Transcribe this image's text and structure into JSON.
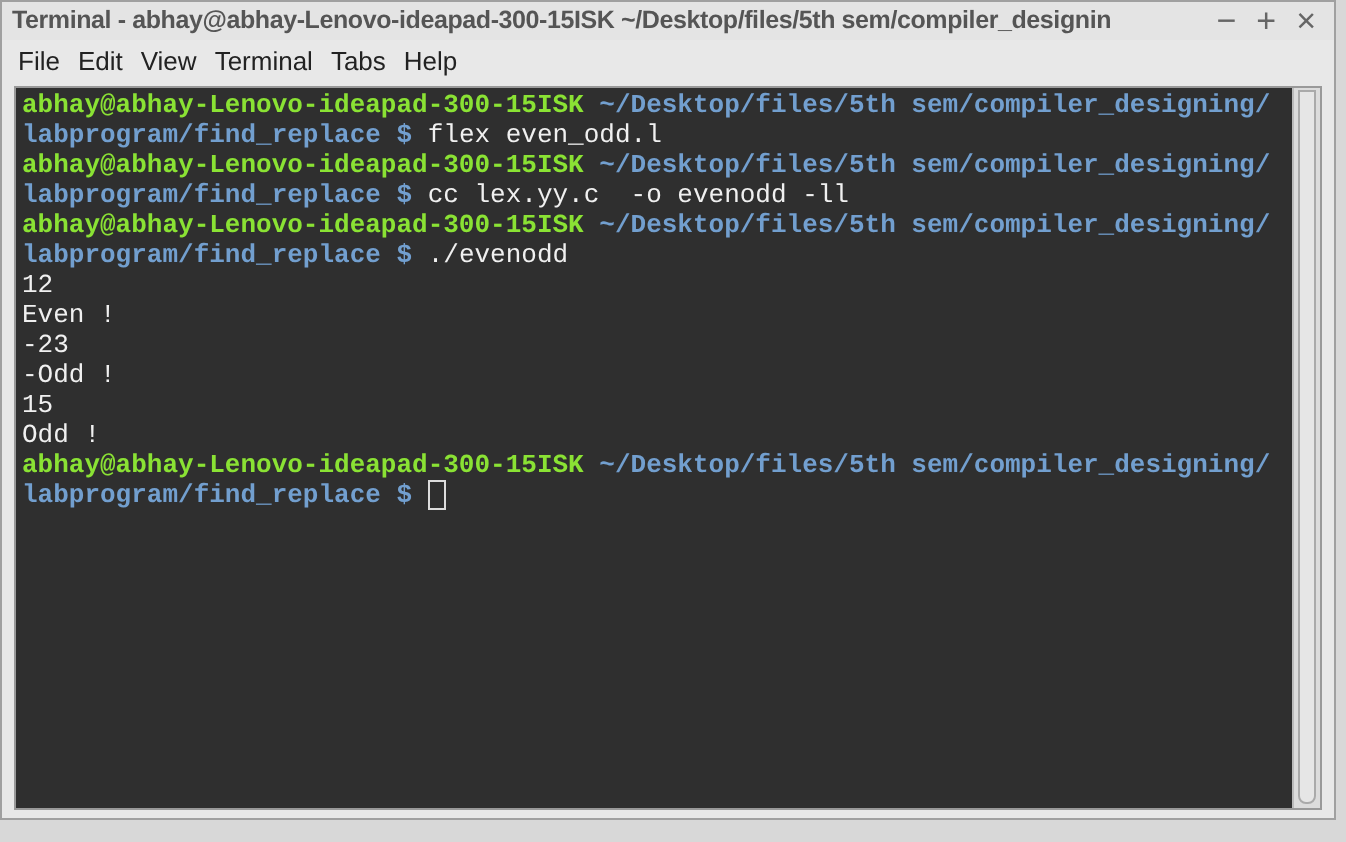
{
  "window": {
    "title": "Terminal - abhay@abhay-Lenovo-ideapad-300-15ISK ~/Desktop/files/5th sem/compiler_designin",
    "controls": [
      "−",
      "+",
      "×"
    ]
  },
  "menu": [
    "File",
    "Edit",
    "View",
    "Terminal",
    "Tabs",
    "Help"
  ],
  "terminal": {
    "rows": [
      [
        {
          "kind": "user",
          "text": "abhay@abhay-Lenovo-ideapad-300-15ISK"
        },
        {
          "kind": "path",
          "text": " ~/Desktop/files/5th sem/compiler_designing/"
        }
      ],
      [
        {
          "kind": "path",
          "text": "labprogram/find_replace $"
        },
        {
          "kind": "command",
          "text": " flex even_odd.l"
        }
      ],
      [
        {
          "kind": "user",
          "text": "abhay@abhay-Lenovo-ideapad-300-15ISK"
        },
        {
          "kind": "path",
          "text": " ~/Desktop/files/5th sem/compiler_designing/"
        }
      ],
      [
        {
          "kind": "path",
          "text": "labprogram/find_replace $"
        },
        {
          "kind": "command",
          "text": " cc lex.yy.c  -o evenodd -ll"
        }
      ],
      [
        {
          "kind": "user",
          "text": "abhay@abhay-Lenovo-ideapad-300-15ISK"
        },
        {
          "kind": "path",
          "text": " ~/Desktop/files/5th sem/compiler_designing/"
        }
      ],
      [
        {
          "kind": "path",
          "text": "labprogram/find_replace $"
        },
        {
          "kind": "command",
          "text": " ./evenodd"
        }
      ],
      [
        {
          "kind": "output",
          "text": "12"
        }
      ],
      [
        {
          "kind": "output",
          "text": "Even !"
        }
      ],
      [
        {
          "kind": "output",
          "text": "-23"
        }
      ],
      [
        {
          "kind": "output",
          "text": "-Odd !"
        }
      ],
      [
        {
          "kind": "output",
          "text": "15"
        }
      ],
      [
        {
          "kind": "output",
          "text": "Odd !"
        }
      ],
      [
        {
          "kind": "user",
          "text": "abhay@abhay-Lenovo-ideapad-300-15ISK"
        },
        {
          "kind": "path",
          "text": " ~/Desktop/files/5th sem/compiler_designing/"
        }
      ],
      [
        {
          "kind": "path",
          "text": "labprogram/find_replace $"
        },
        {
          "kind": "cursor",
          "text": ""
        }
      ]
    ]
  }
}
